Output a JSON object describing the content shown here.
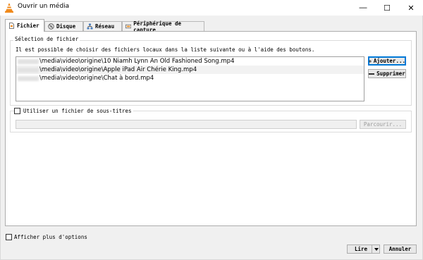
{
  "window": {
    "title": "Ouvrir un média"
  },
  "titlebar": {
    "minimize": "—",
    "maximize": "☐",
    "close": "✕"
  },
  "tabs": [
    {
      "label": "Fichier",
      "icon": "file-icon"
    },
    {
      "label": "Disque",
      "icon": "disc-icon"
    },
    {
      "label": "Réseau",
      "icon": "network-icon"
    },
    {
      "label": "Périphérique de capture",
      "icon": "capture-device-icon"
    }
  ],
  "file_selection": {
    "title": "Sélection de fichier",
    "hint": "Il est possible de choisir des fichiers locaux dans la liste suivante ou à l'aide des boutons.",
    "files": [
      "\\media\\video\\origine\\10 Niamh Lynn An Old Fashioned Song.mp4",
      "\\media\\video\\origine\\Apple iPad Air Chérie King.mp4",
      "\\media\\video\\origine\\Chat à bord.mp4"
    ],
    "add_button": "Ajouter...",
    "remove_button": "Supprimer"
  },
  "subtitles": {
    "checkbox_label": "Utiliser un fichier de sous-titres",
    "checked": false,
    "path_value": "",
    "browse_button": "Parcourir..."
  },
  "footer": {
    "more_options_label": "Afficher plus d'options",
    "play_button": "Lire",
    "cancel_button": "Annuler"
  },
  "colors": {
    "accent": "#0078d7",
    "vlc_orange": "#f08a1c"
  }
}
